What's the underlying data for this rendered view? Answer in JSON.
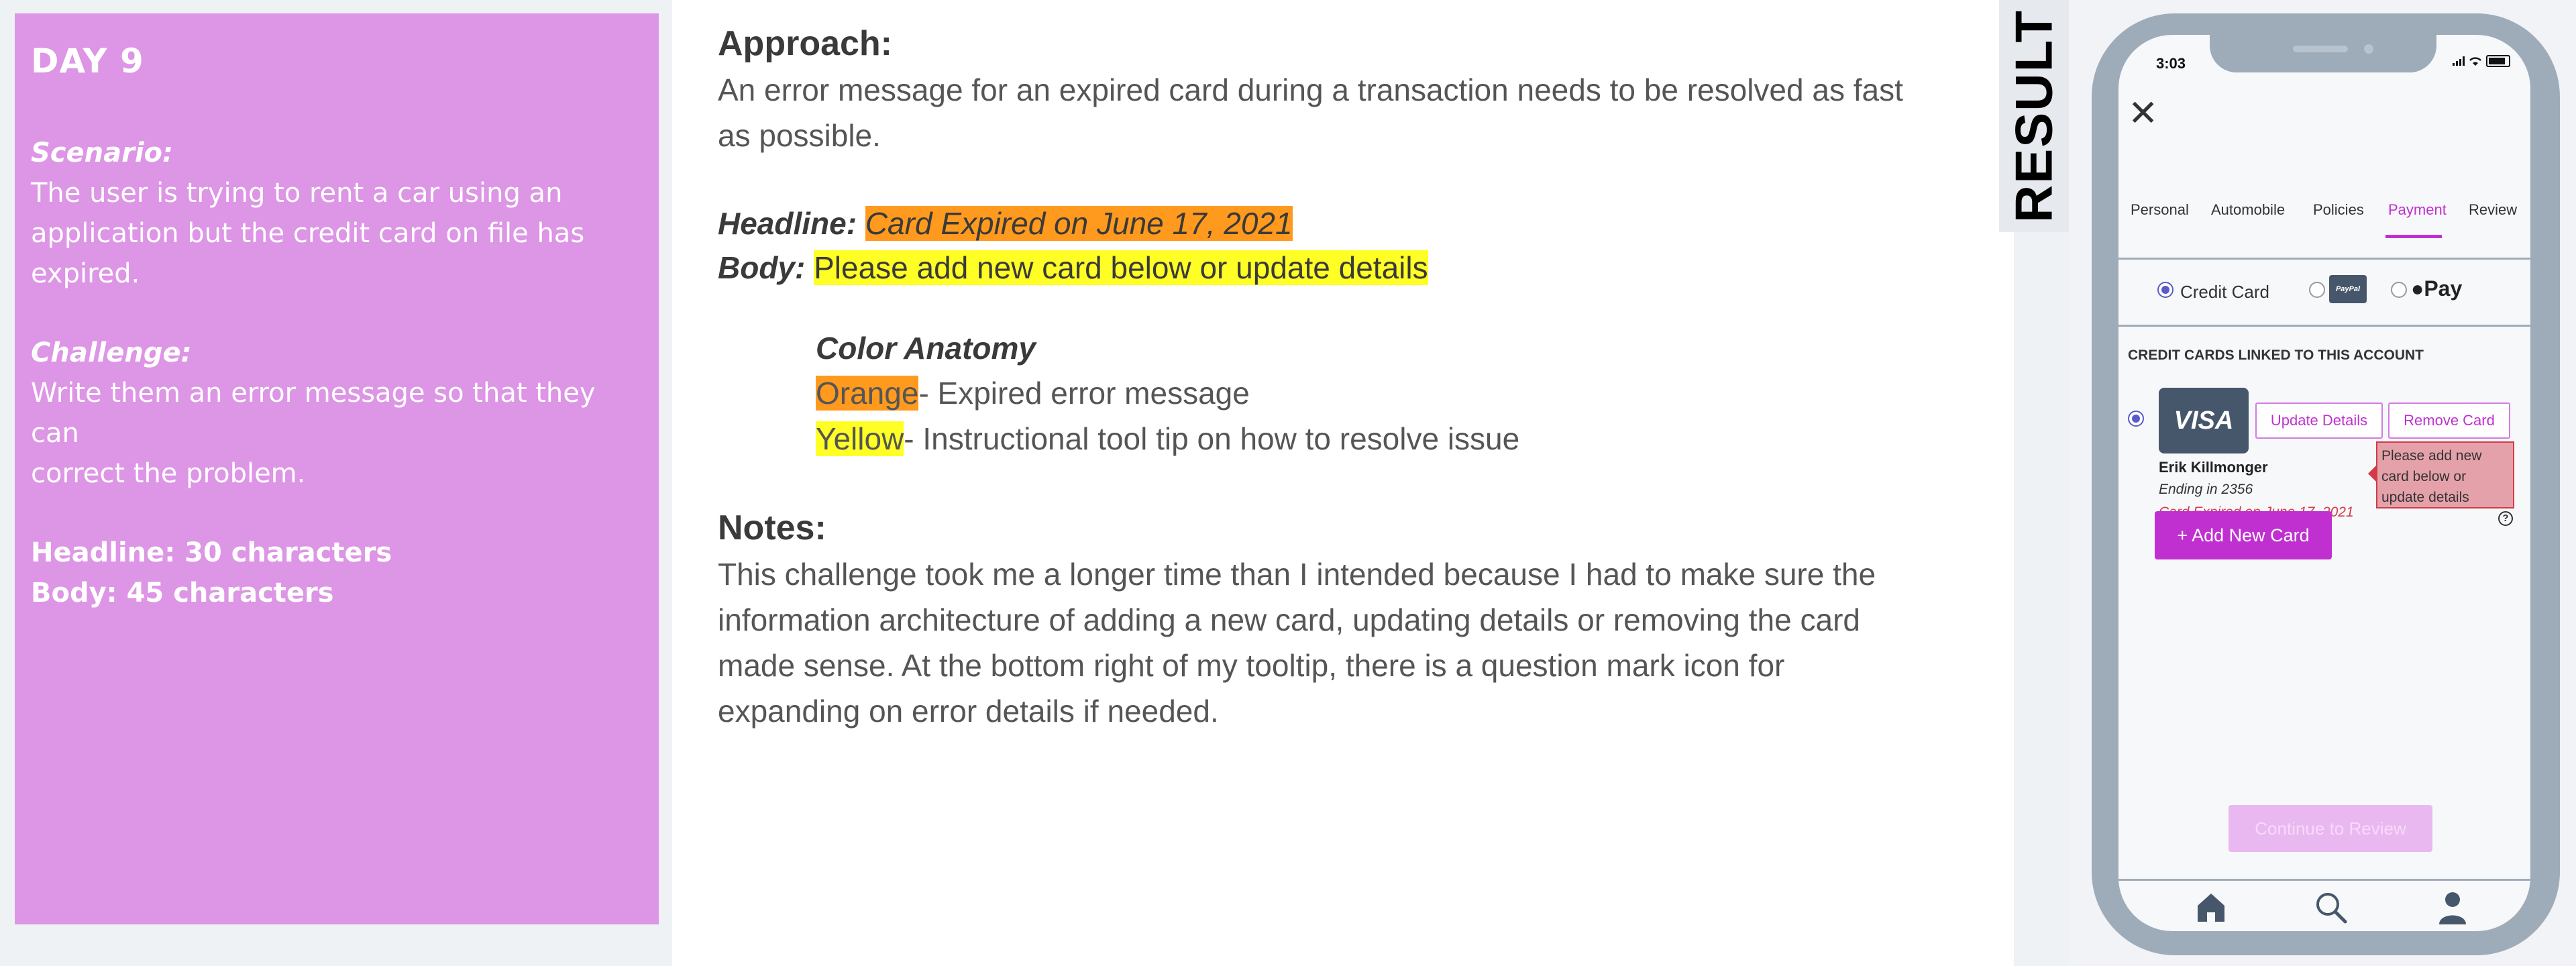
{
  "left_panel": {
    "day": "DAY 9",
    "scenario_heading": "Scenario:",
    "scenario_line1": "The user is trying to rent a car using an",
    "scenario_line2": "application but the credit card on file has expired.",
    "challenge_heading": "Challenge:",
    "challenge_line1": "Write them an error message so that they can",
    "challenge_line2": "correct the problem.",
    "headline_limit": "Headline: 30 characters",
    "body_limit": "Body: 45 characters",
    "bg_color": "#dd95e5"
  },
  "document": {
    "approach_heading": "Approach:",
    "approach_line1": "An error message for an expired card during a transaction needs to be resolved as fast",
    "approach_line2": "as possible.",
    "headline_label": "Headline:",
    "headline_text": "Card Expired on June 17, 2021",
    "body_label": "Body:",
    "body_text": "Please add new card below or update details",
    "anatomy_title": "Color Anatomy",
    "orange_word": "Orange",
    "orange_desc": "- Expired error message",
    "yellow_word": "Yellow",
    "yellow_desc": "- Instructional tool tip on how to resolve issue",
    "notes_heading": "Notes:",
    "notes_line1": "This challenge took me a longer time than I intended because I had to make sure the",
    "notes_line2": "information architecture of adding a new card, updating details or removing the card",
    "notes_line3": "made sense. At the bottom right of my tooltip, there is a question mark icon for",
    "notes_line4": "expanding on error details if needed.",
    "highlight_orange": "#ff9a1e",
    "highlight_yellow": "#ffff26"
  },
  "result_label": "RESULT",
  "phone": {
    "time": "3:03",
    "close_icon": "close-icon",
    "tabs": [
      {
        "label": "Personal"
      },
      {
        "label": "Automobile"
      },
      {
        "label": "Policies"
      },
      {
        "label": "Payment"
      },
      {
        "label": "Review"
      }
    ],
    "active_tab": "Payment",
    "payment_methods": {
      "credit_card": "Credit Card",
      "paypal": "PayPal",
      "applepay": "Pay"
    },
    "linked_title": "CREDIT CARDS LINKED TO THIS ACCOUNT",
    "card": {
      "brand": "VISA",
      "update_label": "Update Details",
      "remove_label": "Remove Card",
      "owner": "Erik Killmonger",
      "ending": "Ending in 2356",
      "expired": "Card Expired on June 17, 2021"
    },
    "tooltip": "Please add new card below or update details",
    "help_icon_label": "?",
    "add_card_label": "+ Add New Card",
    "continue_label": "Continue to Review",
    "accent_color": "#c030d0",
    "error_color": "#d23a48"
  }
}
